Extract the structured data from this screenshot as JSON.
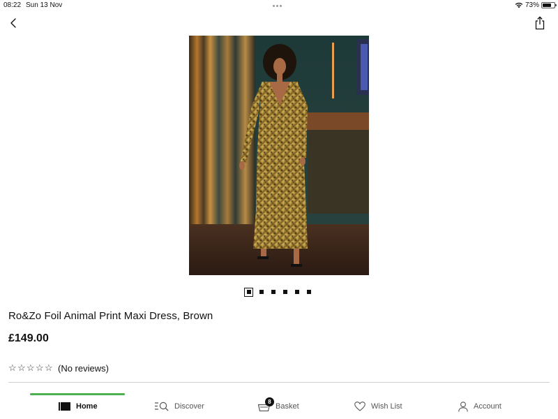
{
  "status_bar": {
    "time": "08:22",
    "date": "Sun 13 Nov",
    "battery": "73%",
    "battery_level": 0.73
  },
  "header": {
    "back_icon": "chevron-left-icon",
    "share_icon": "share-icon"
  },
  "carousel": {
    "count": 6,
    "active_index": 0
  },
  "product": {
    "title": "Ro&Zo Foil Animal Print Maxi Dress, Brown",
    "price": "£149.00",
    "stars": [
      "☆",
      "☆",
      "☆",
      "☆",
      "☆"
    ],
    "rating_value": 0,
    "reviews": "(No reviews)"
  },
  "tabs": [
    {
      "label": "Home",
      "icon": "home-icon",
      "active": true
    },
    {
      "label": "Discover",
      "icon": "discover-icon",
      "active": false
    },
    {
      "label": "Basket",
      "icon": "basket-icon",
      "active": false,
      "badge": "8"
    },
    {
      "label": "Wish List",
      "icon": "heart-icon",
      "active": false
    },
    {
      "label": "Account",
      "icon": "person-icon",
      "active": false
    }
  ],
  "colors": {
    "accent": "#4caf50",
    "text": "#111111",
    "divider": "#cfcfcf"
  }
}
